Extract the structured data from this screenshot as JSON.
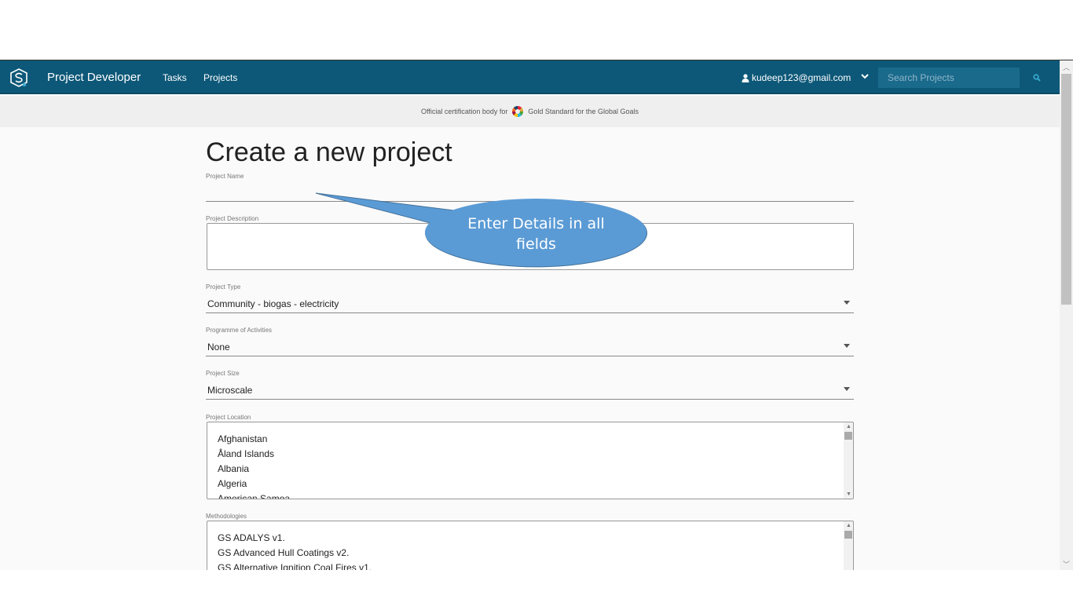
{
  "nav": {
    "brand": "Project Developer",
    "links": [
      "Tasks",
      "Projects"
    ],
    "user_email": "kudeep123@gmail.com",
    "search_placeholder": "Search Projects"
  },
  "cert_bar": {
    "prefix": "Official certification body for",
    "org": "Gold Standard for the Global Goals"
  },
  "form": {
    "title": "Create a new project",
    "project_name": {
      "label": "Project Name",
      "value": ""
    },
    "project_description": {
      "label": "Project Description",
      "value": ""
    },
    "project_type": {
      "label": "Project Type",
      "value": "Community - biogas - electricity"
    },
    "programme": {
      "label": "Programme of Activities",
      "value": "None"
    },
    "project_size": {
      "label": "Project Size",
      "value": "Microscale"
    },
    "project_location": {
      "label": "Project Location",
      "options": [
        "Afghanistan",
        "Åland Islands",
        "Albania",
        "Algeria",
        "American Samoa"
      ]
    },
    "methodologies": {
      "label": "Methodologies",
      "options": [
        "GS ADALYS v1.",
        "GS Advanced Hull Coatings v2.",
        "GS Alternative Ignition Coal Fires v1."
      ]
    }
  },
  "callout": {
    "line1": "Enter Details in all",
    "line2": "fields",
    "color": "#5b9bd5"
  },
  "colors": {
    "navbar": "#0d5878",
    "accent": "#3ab0d6"
  }
}
